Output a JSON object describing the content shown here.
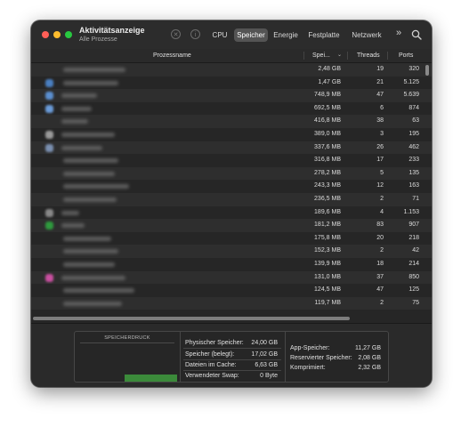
{
  "window": {
    "title": "Aktivitätsanzeige",
    "subtitle": "Alle Prozesse",
    "tabs": [
      {
        "label": "CPU",
        "active": false
      },
      {
        "label": "Speicher",
        "active": true
      },
      {
        "label": "Energie",
        "active": false
      },
      {
        "label": "Festplatte",
        "active": false
      },
      {
        "label": "Netzwerk",
        "active": false
      }
    ],
    "more_label": "»"
  },
  "table": {
    "headers": {
      "name": "Prozessname",
      "memory": "Spei...",
      "threads": "Threads",
      "ports": "Ports"
    },
    "rows": [
      {
        "memory": "2,48 GB",
        "threads": "19",
        "ports": "320"
      },
      {
        "memory": "1,47 GB",
        "threads": "21",
        "ports": "5.125"
      },
      {
        "memory": "748,9 MB",
        "threads": "47",
        "ports": "5.639"
      },
      {
        "memory": "692,5 MB",
        "threads": "6",
        "ports": "874"
      },
      {
        "memory": "416,8 MB",
        "threads": "38",
        "ports": "63"
      },
      {
        "memory": "389,0 MB",
        "threads": "3",
        "ports": "195"
      },
      {
        "memory": "337,6 MB",
        "threads": "26",
        "ports": "462"
      },
      {
        "memory": "316,8 MB",
        "threads": "17",
        "ports": "233"
      },
      {
        "memory": "278,2 MB",
        "threads": "5",
        "ports": "135"
      },
      {
        "memory": "243,3 MB",
        "threads": "12",
        "ports": "163"
      },
      {
        "memory": "236,5 MB",
        "threads": "2",
        "ports": "71"
      },
      {
        "memory": "189,6 MB",
        "threads": "4",
        "ports": "1.153"
      },
      {
        "memory": "181,2 MB",
        "threads": "83",
        "ports": "907"
      },
      {
        "memory": "175,8 MB",
        "threads": "20",
        "ports": "218"
      },
      {
        "memory": "152,3 MB",
        "threads": "2",
        "ports": "42"
      },
      {
        "memory": "139,9 MB",
        "threads": "18",
        "ports": "214"
      },
      {
        "memory": "131,0 MB",
        "threads": "37",
        "ports": "850"
      },
      {
        "memory": "124,5 MB",
        "threads": "47",
        "ports": "125"
      },
      {
        "memory": "119,7 MB",
        "threads": "2",
        "ports": "75"
      }
    ]
  },
  "summary": {
    "pressure_title": "SPEICHERDRUCK",
    "pressure_level": 0.15,
    "pressure_color": "#3b8a3a",
    "physical_label": "Physischer Speicher:",
    "physical_value": "24,00 GB",
    "used_label": "Speicher (belegt):",
    "used_value": "17,02 GB",
    "cache_label": "Dateien im Cache:",
    "cache_value": "6,63 GB",
    "swap_label": "Verwendeter Swap:",
    "swap_value": "0 Byte",
    "app_label": "App-Speicher:",
    "app_value": "11,27 GB",
    "wired_label": "Reservierter Speicher:",
    "wired_value": "2,08 GB",
    "compressed_label": "Komprimiert:",
    "compressed_value": "2,32 GB"
  },
  "colors": {
    "close": "#ff5f57",
    "minimize": "#febc2e",
    "zoom": "#28c840",
    "active_tab": "#545454"
  },
  "icons": {
    "stop": "stop-process-icon",
    "info": "info-icon",
    "more": "chevron-double-right-icon",
    "search": "search-icon"
  }
}
